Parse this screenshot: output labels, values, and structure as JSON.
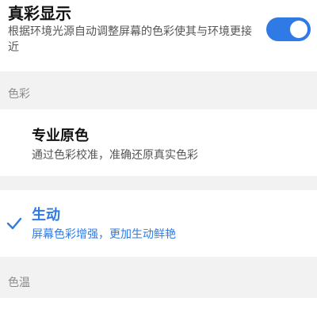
{
  "true_color": {
    "title": "真彩显示",
    "description": "根据环境光源自动调整屏幕的色彩使其与环境更接近",
    "enabled": true
  },
  "color_section": {
    "label": "色彩",
    "options": [
      {
        "title": "专业原色",
        "description": "通过色彩校准，准确还原真实色彩",
        "selected": false
      },
      {
        "title": "生动",
        "description": "屏幕色彩增强，更加生动鲜艳",
        "selected": true
      }
    ]
  },
  "temperature_section": {
    "label": "色温"
  },
  "colors": {
    "accent": "#2f7ae5",
    "background": "#f2f2f2",
    "card": "#ffffff"
  }
}
